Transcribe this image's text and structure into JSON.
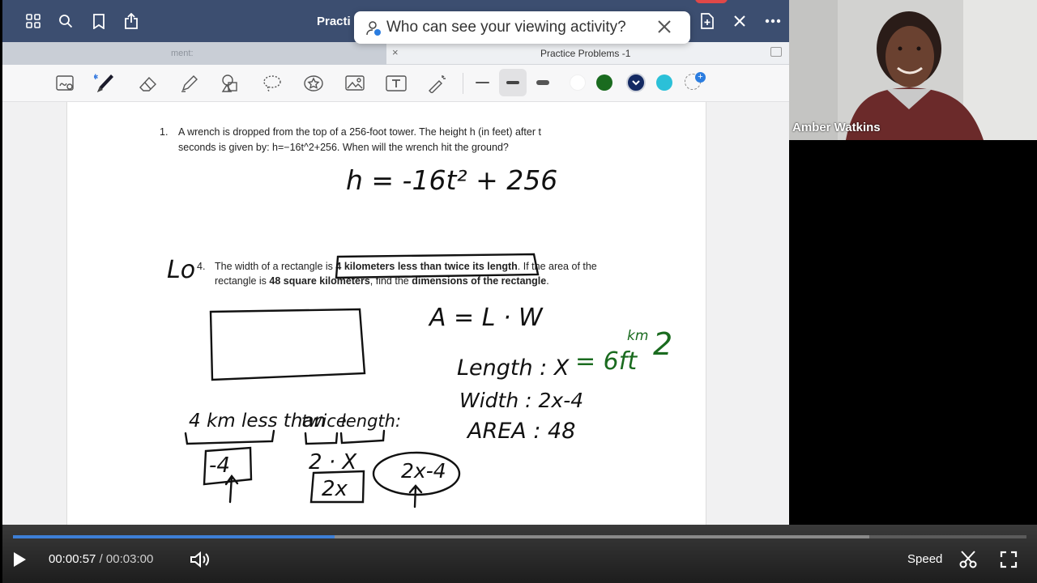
{
  "app": {
    "title": "Practi",
    "tabs": {
      "left_label": "ment:",
      "close_glyph": "×",
      "right_label": "Practice Problems -1"
    },
    "icons": {
      "grid": "grid-icon",
      "search": "search-icon",
      "bookmark": "bookmark-icon",
      "share": "share-icon",
      "new_page": "new-page-icon",
      "close": "close-icon",
      "more": "more-icon"
    }
  },
  "popup": {
    "text": "Who can see your viewing activity?"
  },
  "toolbar": {
    "tools": [
      "lasso-image-icon",
      "pen-icon",
      "eraser-icon",
      "highlighter-icon",
      "shapes-icon",
      "lasso-icon",
      "sticker-icon",
      "image-icon",
      "text-icon",
      "laser-pointer-icon"
    ],
    "colors": [
      "#1a6b1f",
      "#142a63",
      "#2bc0d8"
    ],
    "selected_color": "#142a63"
  },
  "document": {
    "q1_number": "1.",
    "q1_line1": "A wrench is dropped from the top of a 256-foot tower. The height h (in feet) after t",
    "q1_line2": "seconds is given by: h=−16t^2+256. When will the wrench hit the ground?",
    "q4_number": "4.",
    "q4_part1": "The width of a rectangle is ",
    "q4_bold1": "4 kilometers less than twice its length",
    "q4_part2": ". If the area of the",
    "q4_part3": "rectangle is ",
    "q4_bold2": "48 square kilometers",
    "q4_part4": ", find the ",
    "q4_bold3": "dimensions of the rectangle",
    "q4_part5": "."
  },
  "handwriting": {
    "eq1": "h = -16t² + 256",
    "lo": "Lo",
    "area_formula": "A = L · W",
    "length": "Length : X",
    "width": "Width : 2x-4",
    "area": "AREA : 48",
    "equals": "= 6ft",
    "units": "km",
    "squared": "2",
    "phrase1": "4 km less than",
    "phrase2": "twice",
    "phrase3": "length:",
    "box_minus4": "-4",
    "two_x": "2 · X",
    "box_2x": "2x",
    "oval_2x4": "2x-4"
  },
  "webcam": {
    "name": "Amber Watkins"
  },
  "player": {
    "current_time": "00:00:57",
    "separator": "/",
    "duration": "00:03:00",
    "progress_fraction": 0.317,
    "buffered_fraction": 0.845,
    "speed_label": "Speed"
  }
}
